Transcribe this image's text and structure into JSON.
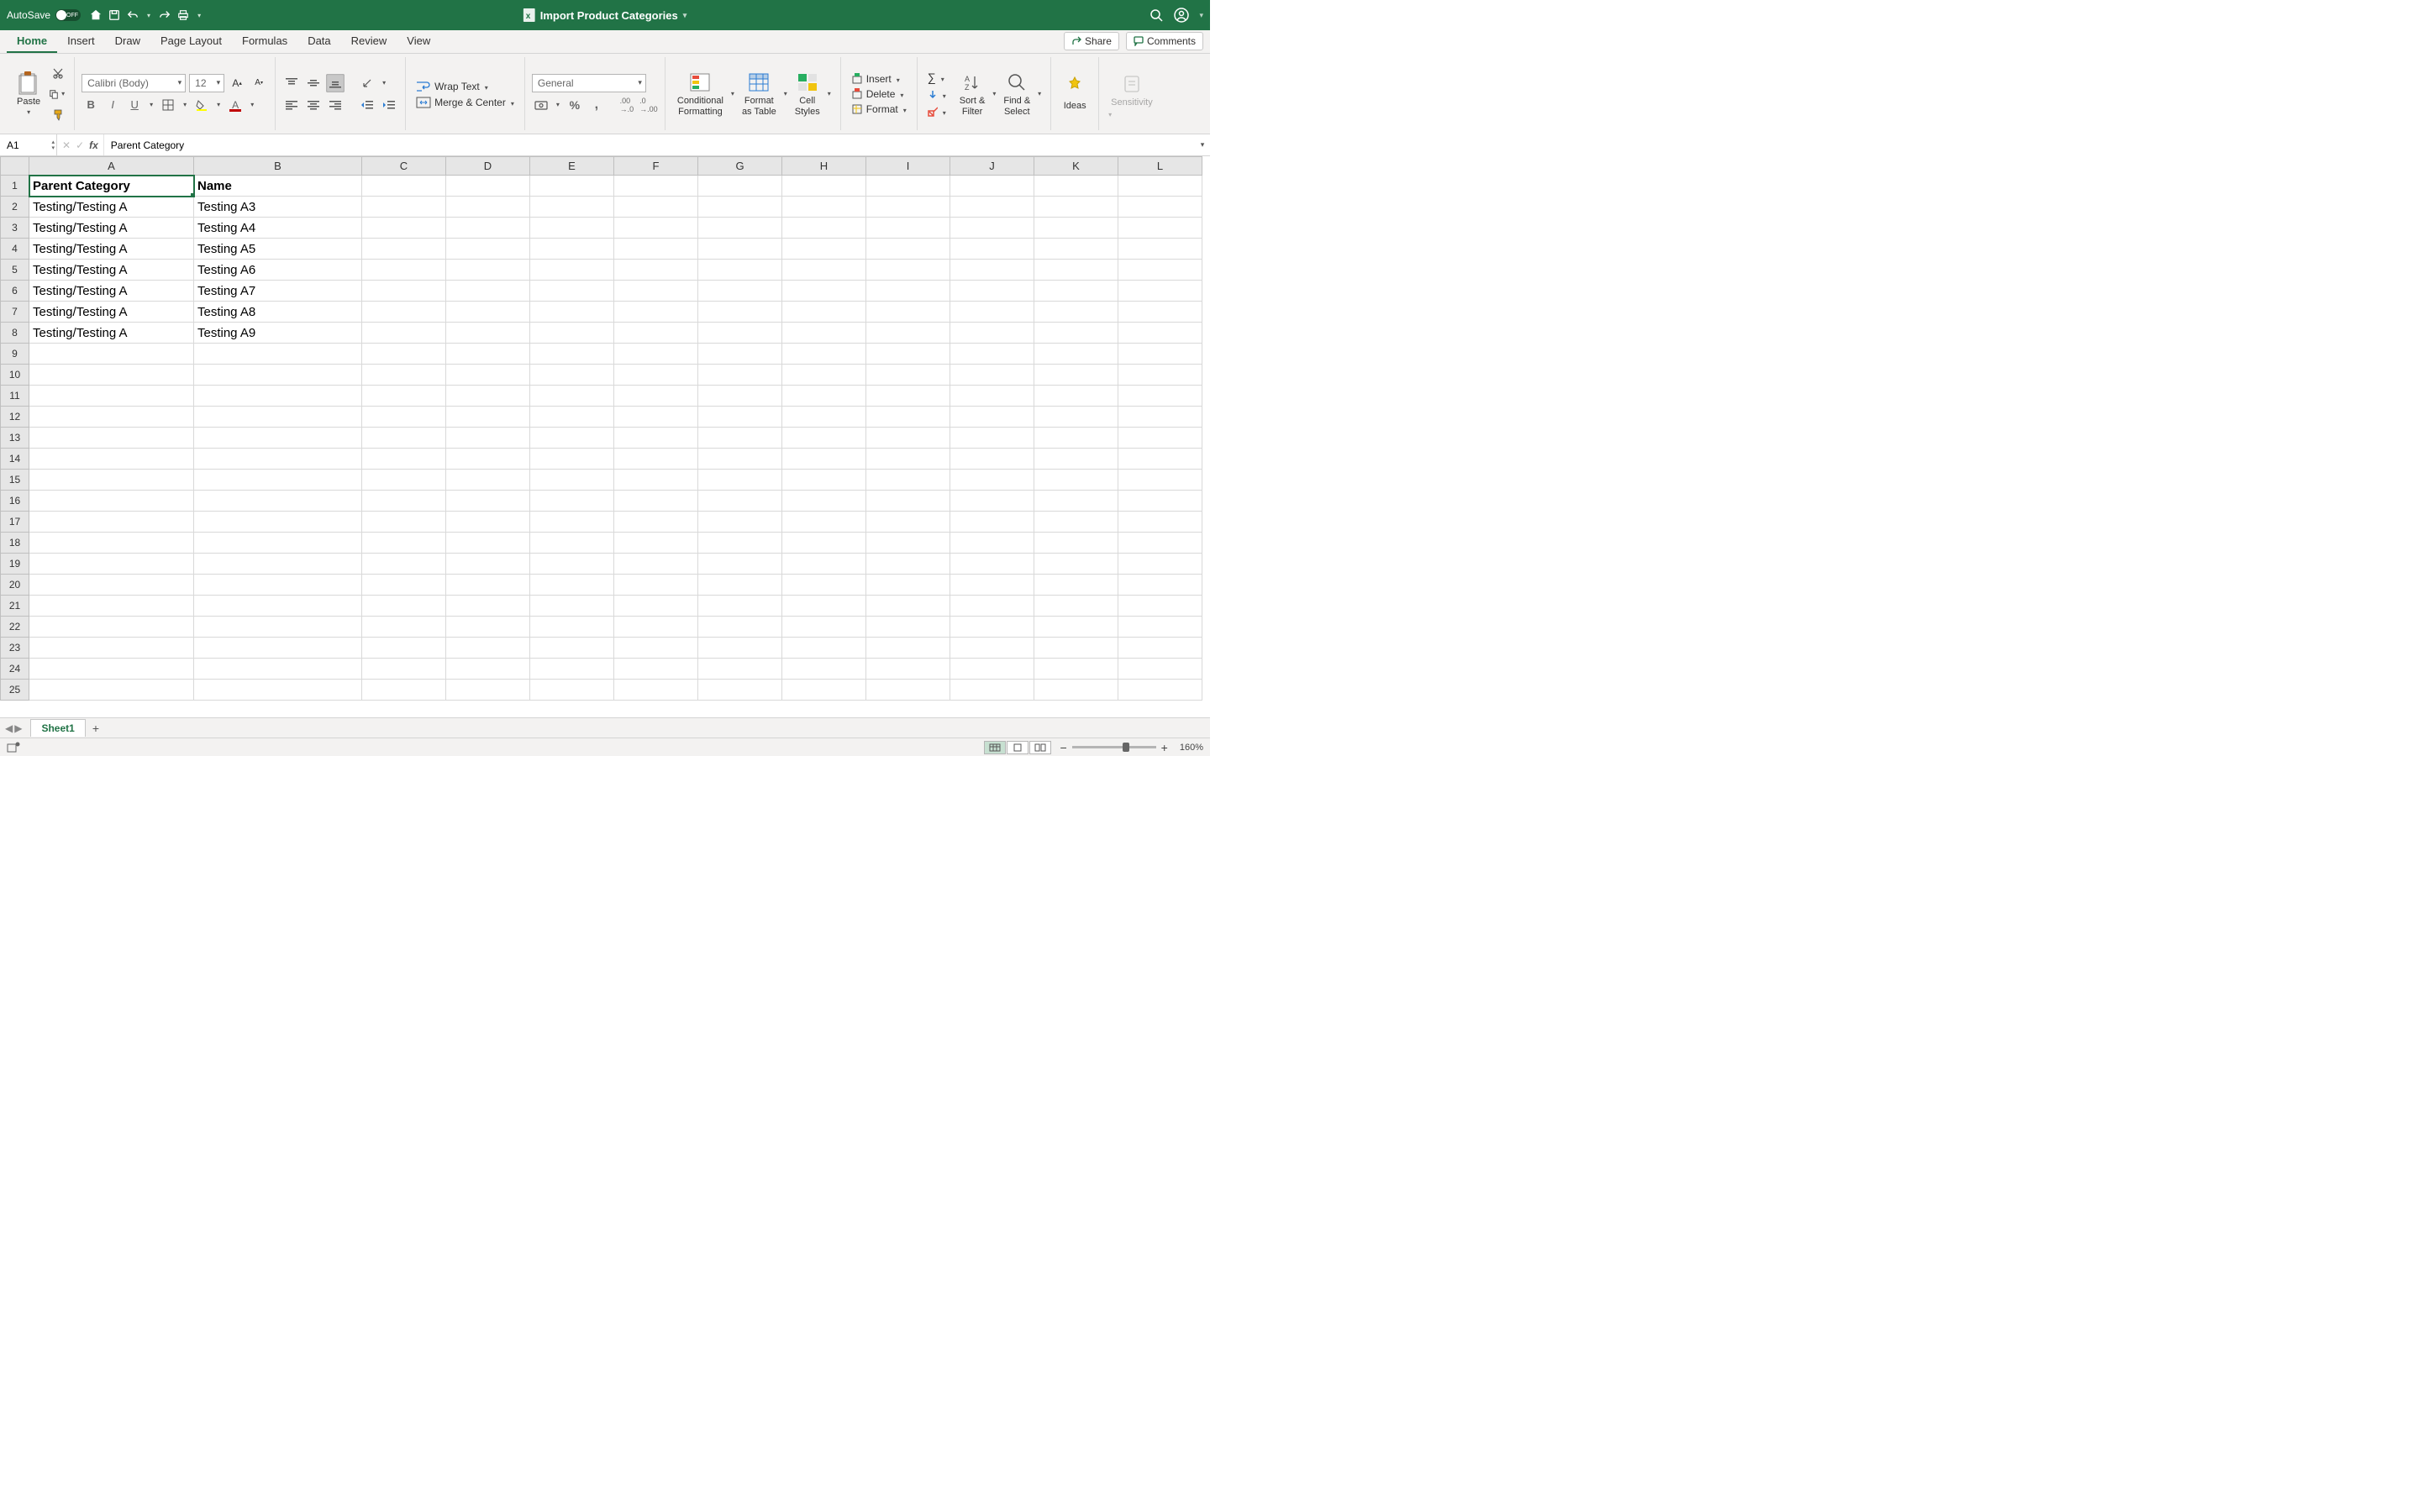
{
  "titlebar": {
    "autosave_label": "AutoSave",
    "autosave_state": "OFF",
    "doc_title": "Import Product Categories"
  },
  "ribbon_tabs": [
    "Home",
    "Insert",
    "Draw",
    "Page Layout",
    "Formulas",
    "Data",
    "Review",
    "View"
  ],
  "ribbon_active_tab": "Home",
  "ribbon_right": {
    "share": "Share",
    "comments": "Comments"
  },
  "ribbon_home": {
    "paste": "Paste",
    "font_name": "Calibri (Body)",
    "font_size": "12",
    "wrap_text": "Wrap Text",
    "merge_center": "Merge & Center",
    "number_format": "General",
    "conditional_formatting": "Conditional\nFormatting",
    "format_as_table": "Format\nas Table",
    "cell_styles": "Cell\nStyles",
    "insert": "Insert",
    "delete": "Delete",
    "format": "Format",
    "sort_filter": "Sort &\nFilter",
    "find_select": "Find &\nSelect",
    "ideas": "Ideas",
    "sensitivity": "Sensitivity"
  },
  "name_box": "A1",
  "formula_value": "Parent Category",
  "columns": [
    "A",
    "B",
    "C",
    "D",
    "E",
    "F",
    "G",
    "H",
    "I",
    "J",
    "K",
    "L"
  ],
  "col_widths": {
    "A": 196,
    "B": 200
  },
  "rows_visible": 25,
  "selected_cell": "A1",
  "data": {
    "1": {
      "A": "Parent Category",
      "B": "Name"
    },
    "2": {
      "A": "Testing/Testing A",
      "B": "Testing A3"
    },
    "3": {
      "A": "Testing/Testing A",
      "B": "Testing A4"
    },
    "4": {
      "A": "Testing/Testing A",
      "B": "Testing A5"
    },
    "5": {
      "A": "Testing/Testing A",
      "B": "Testing A6"
    },
    "6": {
      "A": "Testing/Testing A",
      "B": "Testing A7"
    },
    "7": {
      "A": "Testing/Testing A",
      "B": "Testing A8"
    },
    "8": {
      "A": "Testing/Testing A",
      "B": "Testing A9"
    }
  },
  "bold_row": "1",
  "sheet_tabs": [
    "Sheet1"
  ],
  "active_sheet": "Sheet1",
  "zoom": "160%"
}
